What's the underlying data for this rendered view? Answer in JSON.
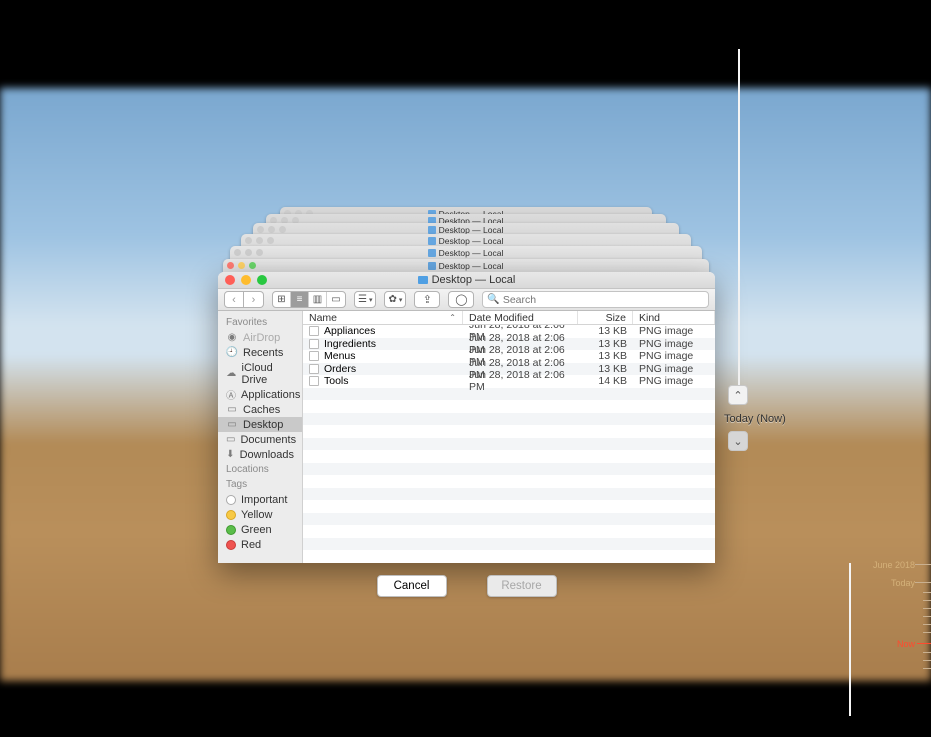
{
  "window_title": "Desktop — Local",
  "stack_titles": [
    "Desktop — Local",
    "Desktop — Local",
    "Desktop — Local",
    "Desktop — Local",
    "Desktop — Local",
    "Desktop — Local"
  ],
  "toolbar": {
    "search_placeholder": "Search"
  },
  "sidebar": {
    "favorites_label": "Favorites",
    "locations_label": "Locations",
    "tags_label": "Tags",
    "items": [
      {
        "label": "AirDrop"
      },
      {
        "label": "Recents"
      },
      {
        "label": "iCloud Drive"
      },
      {
        "label": "Applications"
      },
      {
        "label": "Caches"
      },
      {
        "label": "Desktop"
      },
      {
        "label": "Documents"
      },
      {
        "label": "Downloads"
      }
    ],
    "tags": [
      {
        "label": "Important",
        "color": "#ffffff"
      },
      {
        "label": "Yellow",
        "color": "#f7c945"
      },
      {
        "label": "Green",
        "color": "#5bbd4a"
      },
      {
        "label": "Red",
        "color": "#ef5350"
      }
    ]
  },
  "columns": {
    "name": "Name",
    "date": "Date Modified",
    "size": "Size",
    "kind": "Kind"
  },
  "files": [
    {
      "name": "Appliances",
      "date": "Jun 28, 2018 at 2:06 PM",
      "size": "13 KB",
      "kind": "PNG image"
    },
    {
      "name": "Ingredients",
      "date": "Jun 28, 2018 at 2:06 PM",
      "size": "13 KB",
      "kind": "PNG image"
    },
    {
      "name": "Menus",
      "date": "Jun 28, 2018 at 2:06 PM",
      "size": "13 KB",
      "kind": "PNG image"
    },
    {
      "name": "Orders",
      "date": "Jun 28, 2018 at 2:06 PM",
      "size": "13 KB",
      "kind": "PNG image"
    },
    {
      "name": "Tools",
      "date": "Jun 28, 2018 at 2:06 PM",
      "size": "14 KB",
      "kind": "PNG image"
    }
  ],
  "buttons": {
    "cancel": "Cancel",
    "restore": "Restore"
  },
  "timeline": {
    "current_label": "Today (Now)",
    "labels": {
      "top": "June 2018",
      "today": "Today",
      "now": "Now"
    }
  }
}
